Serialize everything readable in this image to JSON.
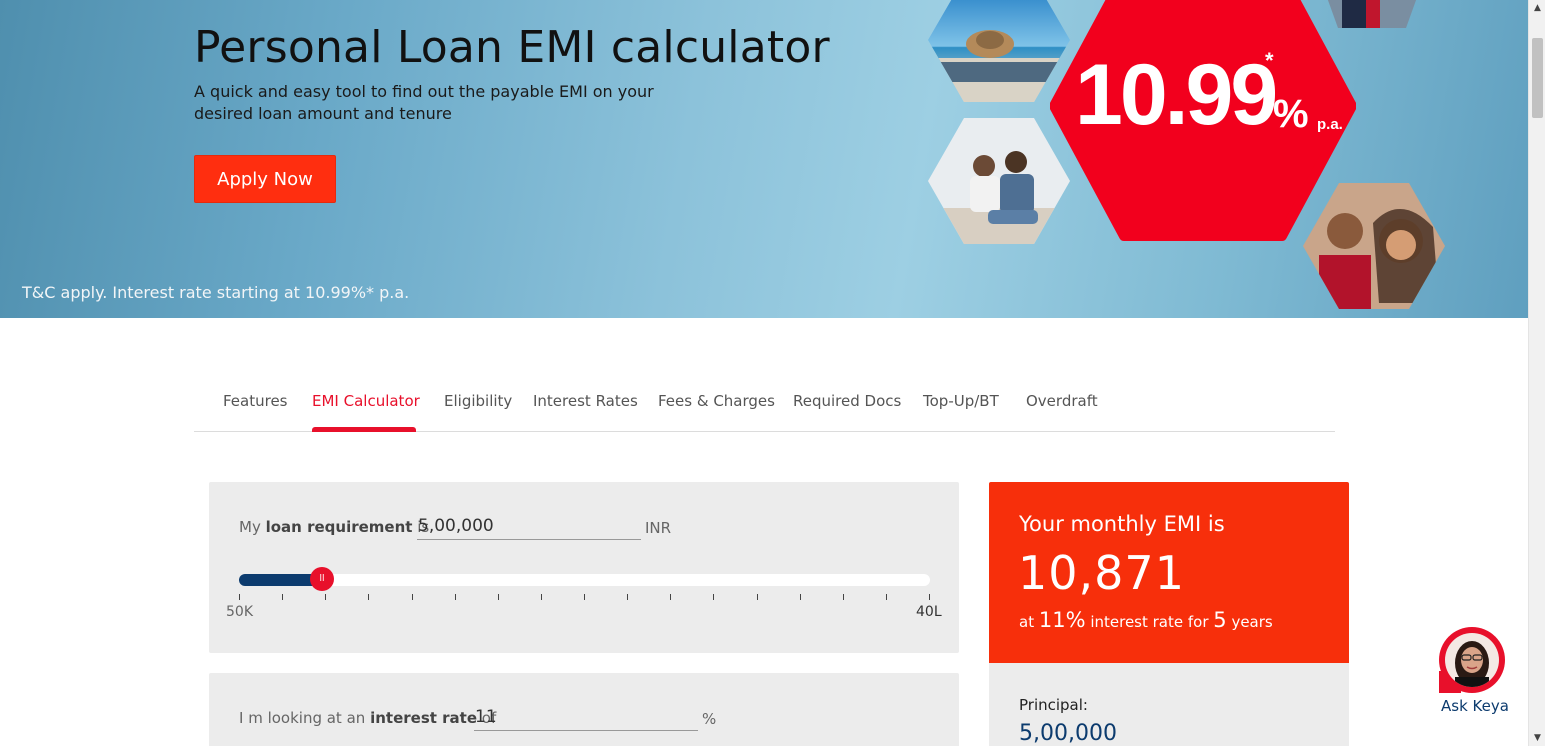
{
  "hero": {
    "title": "Personal Loan EMI calculator",
    "subtitle": "A quick and easy tool to find out the payable EMI on your desired loan amount and tenure",
    "apply_label": "Apply Now",
    "tnc": "T&C apply. Interest rate starting at 10.99%* p.a.",
    "rate_value": "10.99",
    "rate_percent": "%",
    "rate_suffix": "p.a.",
    "rate_star": "*"
  },
  "tabs": [
    {
      "label": "Features"
    },
    {
      "label": "EMI Calculator"
    },
    {
      "label": "Eligibility"
    },
    {
      "label": "Interest Rates"
    },
    {
      "label": "Fees & Charges"
    },
    {
      "label": "Required Docs"
    },
    {
      "label": "Top-Up/BT"
    },
    {
      "label": "Overdraft"
    }
  ],
  "active_tab": "EMI Calculator",
  "loan": {
    "prefix": "My",
    "label_bold": "loan requirement",
    "suffix": "is",
    "value": "5,00,000",
    "unit": "INR",
    "scale_min": "50K",
    "scale_max": "40L",
    "slider_fraction": 0.12
  },
  "interest": {
    "prefix": "I m looking at an",
    "label_bold": "interest rate",
    "suffix": "of",
    "value": "11",
    "unit": "%"
  },
  "result": {
    "title": "Your monthly EMI is",
    "value": "10,871",
    "desc_at": "at",
    "rate": "11%",
    "desc_mid": "interest rate for",
    "years": "5",
    "desc_end": "years",
    "principal_label": "Principal:",
    "principal_value": "5,00,000"
  },
  "assistant": {
    "label": "Ask Keya"
  },
  "colors": {
    "brand_red": "#e8102b",
    "apply_orange": "#ff2e0f",
    "result_bg": "#f72f0b",
    "navy": "#0c3b6e"
  }
}
